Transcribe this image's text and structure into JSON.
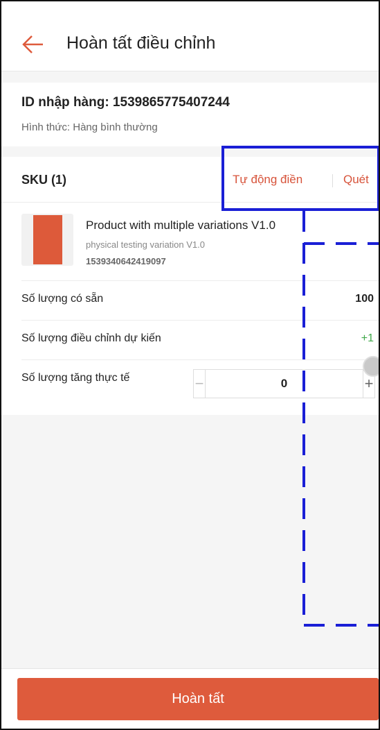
{
  "header": {
    "title": "Hoàn tất điều chỉnh",
    "back_icon": "arrow-left-icon",
    "accent_color": "#de5b3c"
  },
  "info": {
    "id_label": "ID nhập hàng: 1539865775407244",
    "type_label": "Hình thức: Hàng bình thường"
  },
  "sku": {
    "title": "SKU (1)",
    "autofill_label": "Tự động điền",
    "scan_label": "Quét",
    "product": {
      "name": "Product with multiple variations V1.0",
      "variation": "physical testing variation V1.0",
      "sku_id": "1539340642419097"
    },
    "rows": {
      "available": {
        "label": "Số lượng có sẵn",
        "value": "100"
      },
      "expected": {
        "label": "Số lượng điều chỉnh dự kiến",
        "value": "+1"
      },
      "actual": {
        "label": "Số lượng tăng thực tế",
        "value": "0",
        "minus": "−",
        "plus": "+"
      }
    }
  },
  "footer": {
    "complete_label": "Hoàn tất"
  }
}
